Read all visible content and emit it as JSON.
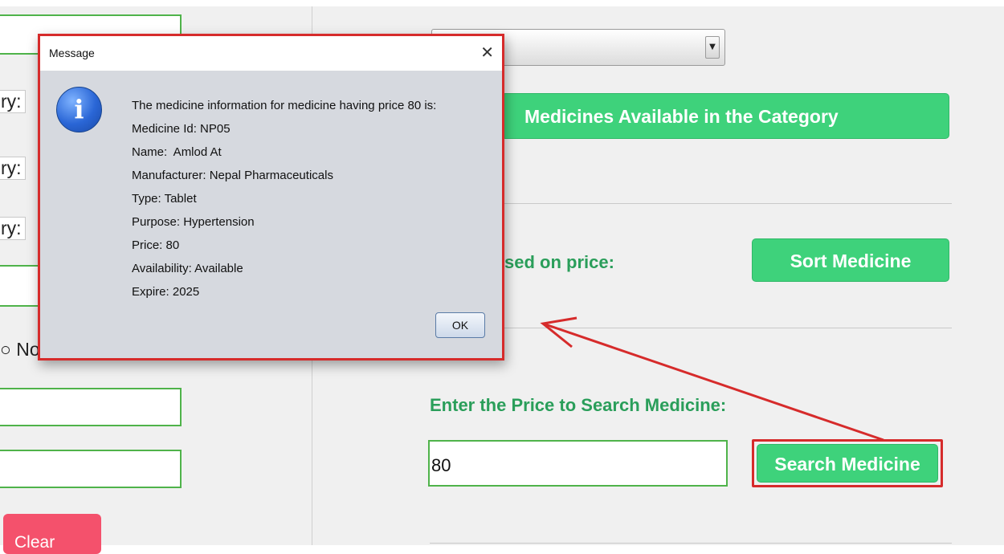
{
  "left_panel": {
    "label_1": "ry:",
    "label_2": "ry:",
    "label_3": "ry:",
    "radio_label": "○ No",
    "clear_label": "Clear"
  },
  "right_panel": {
    "category_button_label": "Medicines Available in the Category",
    "sort_prompt": "sed on price:",
    "sort_button_label": "Sort Medicine",
    "search_prompt": "Enter the Price to Search Medicine:",
    "price_value": "80",
    "search_button_label": "Search Medicine"
  },
  "dialog": {
    "title": "Message",
    "close_glyph": "✕",
    "icon_glyph": "i",
    "lines": [
      "The medicine information for medicine having price 80 is:",
      "Medicine Id: NP05",
      "Name:  Amlod At",
      "Manufacturer: Nepal Pharmaceuticals",
      "Type: Tablet",
      "Purpose: Hypertension",
      "Price: 80",
      "Availability: Available",
      "Expire: 2025"
    ],
    "ok_label": "OK"
  },
  "colors": {
    "green_button": "#3ed27b",
    "green_text": "#2a9e5a",
    "field_border": "#4fb34a",
    "clear_button": "#f4516c",
    "annotation_red": "#d62b2b"
  },
  "icons": [
    "info-icon",
    "close-icon",
    "chevron-down-icon"
  ]
}
